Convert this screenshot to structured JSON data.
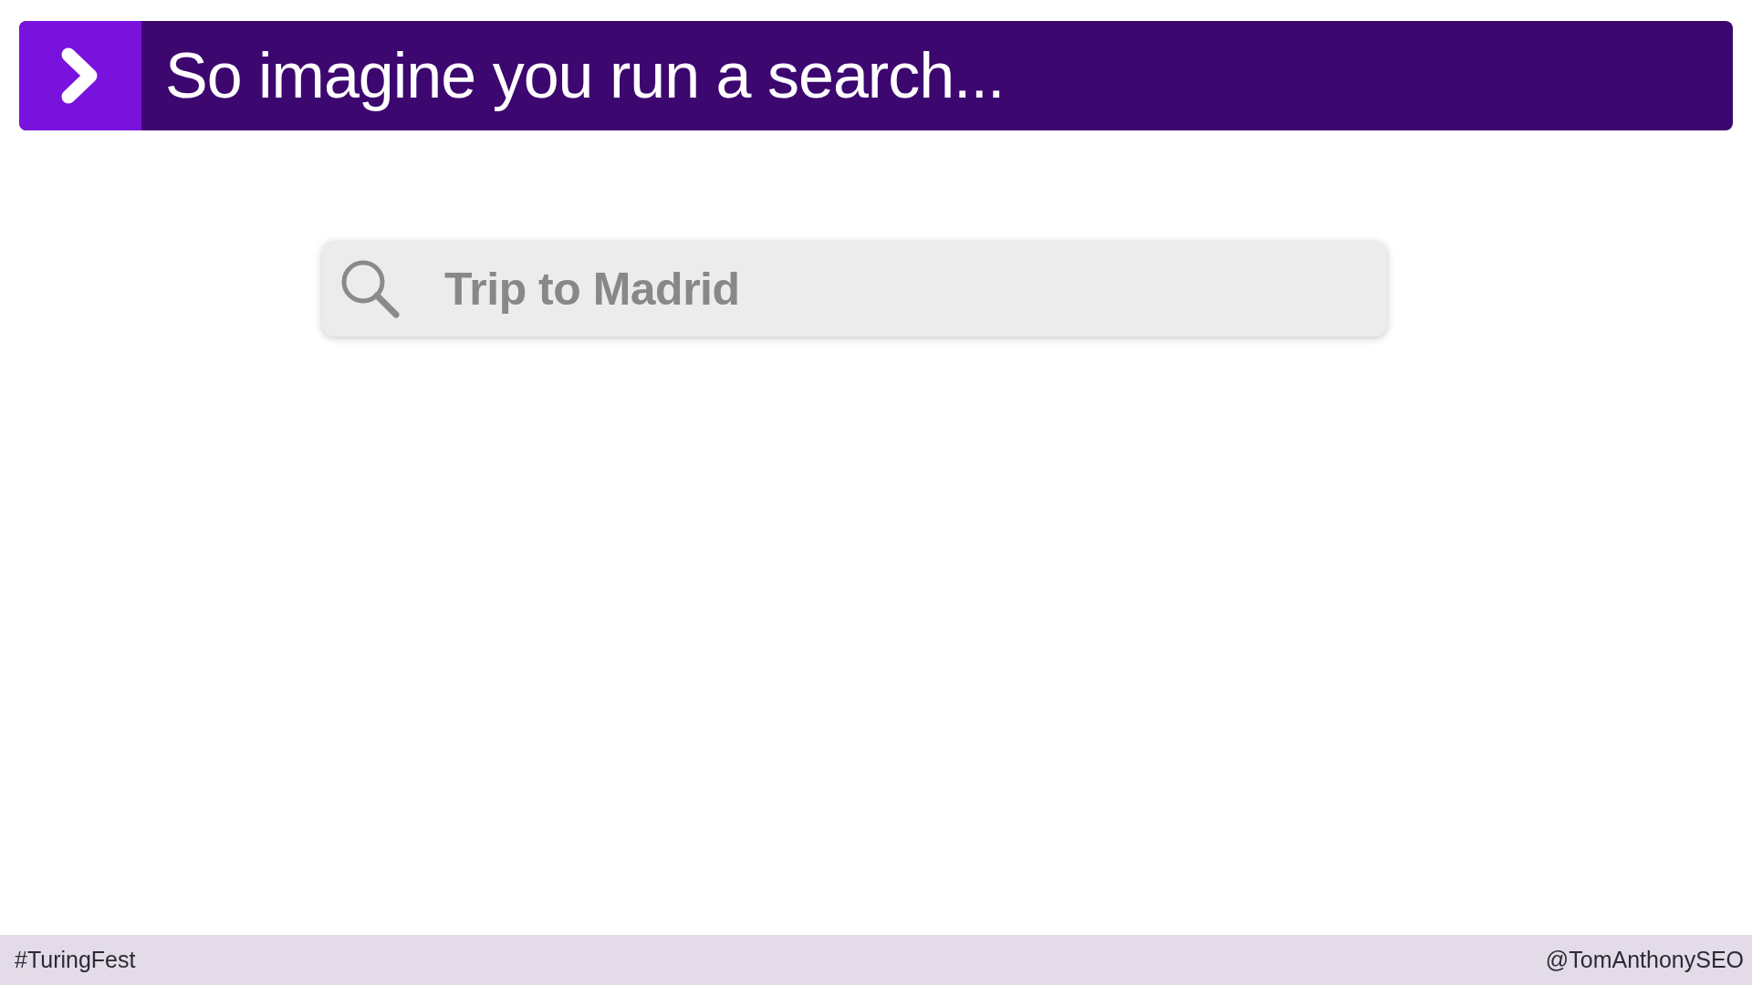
{
  "header": {
    "title": "So imagine you run a search..."
  },
  "search": {
    "value": "Trip to Madrid"
  },
  "footer": {
    "hashtag": "#TuringFest",
    "handle": "@TomAnthonySEO"
  }
}
